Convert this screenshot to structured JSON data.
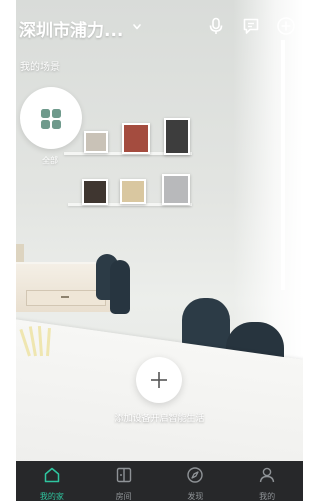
{
  "header": {
    "location": "深圳市浦力...",
    "scene_section_label": "我的场景"
  },
  "scenes": {
    "all_label": "全部"
  },
  "add_device": {
    "hint": "添加设备开启智能生活"
  },
  "bottom_nav": {
    "items": [
      {
        "label": "我的家",
        "icon": "home-icon",
        "active": true
      },
      {
        "label": "房间",
        "icon": "room-icon",
        "active": false
      },
      {
        "label": "发现",
        "icon": "discover-icon",
        "active": false
      },
      {
        "label": "我的",
        "icon": "profile-icon",
        "active": false
      }
    ]
  },
  "colors": {
    "accent": "#2fc6a0",
    "scene_icon": "#6f9a8c",
    "nav_background": "#27282a"
  }
}
